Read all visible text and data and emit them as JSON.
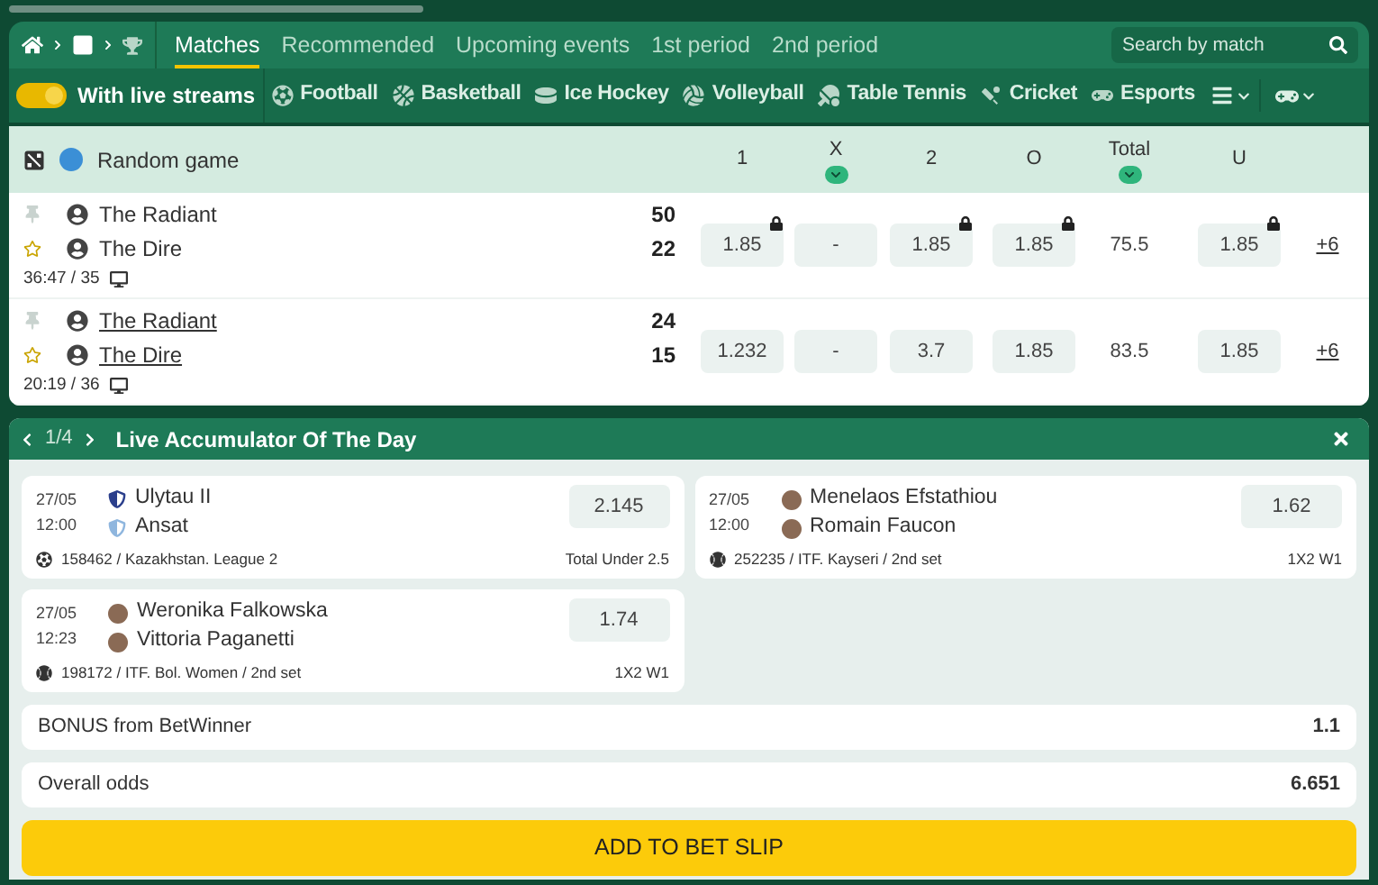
{
  "tabs": [
    {
      "label": "Matches",
      "selected": true
    },
    {
      "label": "Recommended",
      "selected": false
    },
    {
      "label": "Upcoming events",
      "selected": false
    },
    {
      "label": "1st period",
      "selected": false
    },
    {
      "label": "2nd period",
      "selected": false
    }
  ],
  "search": {
    "placeholder": "Search by match"
  },
  "live_toggle": {
    "label": "With live streams",
    "on": true
  },
  "sports": [
    {
      "label": "Football",
      "kind": "football"
    },
    {
      "label": "Basketball",
      "kind": "basketball"
    },
    {
      "label": "Ice Hockey",
      "kind": "hockey"
    },
    {
      "label": "Volleyball",
      "kind": "volleyball"
    },
    {
      "label": "Table Tennis",
      "kind": "tabletennis"
    },
    {
      "label": "Cricket",
      "kind": "cricket"
    },
    {
      "label": "Esports",
      "kind": "esports"
    }
  ],
  "table": {
    "title": "Random game",
    "columns": [
      {
        "label": "1",
        "dropdown": false
      },
      {
        "label": "X",
        "dropdown": true
      },
      {
        "label": "2",
        "dropdown": false
      },
      {
        "label": "O",
        "dropdown": false
      },
      {
        "label": "Total",
        "dropdown": true
      },
      {
        "label": "U",
        "dropdown": false
      }
    ],
    "rows": [
      {
        "teams": [
          {
            "name": "The Radiant",
            "score": "50"
          },
          {
            "name": "The Dire",
            "score": "22"
          }
        ],
        "link": false,
        "time": "36:47 / 35",
        "more": "+6",
        "cells": [
          {
            "kind": "odd",
            "value": "1.85",
            "locked": true
          },
          {
            "kind": "odd",
            "value": "-",
            "locked": false
          },
          {
            "kind": "odd",
            "value": "1.85",
            "locked": true
          },
          {
            "kind": "odd",
            "value": "1.85",
            "locked": true
          },
          {
            "kind": "total",
            "value": "75.5"
          },
          {
            "kind": "odd",
            "value": "1.85",
            "locked": true
          }
        ]
      },
      {
        "teams": [
          {
            "name": "The Radiant",
            "score": "24"
          },
          {
            "name": "The Dire",
            "score": "15"
          }
        ],
        "link": true,
        "time": "20:19 / 36",
        "more": "+6",
        "cells": [
          {
            "kind": "odd",
            "value": "1.232",
            "locked": false
          },
          {
            "kind": "odd",
            "value": "-",
            "locked": false
          },
          {
            "kind": "odd",
            "value": "3.7",
            "locked": false
          },
          {
            "kind": "odd",
            "value": "1.85",
            "locked": false
          },
          {
            "kind": "total",
            "value": "83.5"
          },
          {
            "kind": "odd",
            "value": "1.85",
            "locked": false
          }
        ]
      }
    ]
  },
  "accumulator": {
    "pager": "1/4",
    "title": "Live Accumulator Of The Day",
    "cards": [
      {
        "kind": "football",
        "date": "27/05",
        "time": "12:00",
        "teams": [
          "Ulytau II",
          "Ansat"
        ],
        "odd": "2.145",
        "info": "158462 / Kazakhstan. League 2",
        "bet": "Total Under 2.5"
      },
      {
        "kind": "tennis",
        "date": "27/05",
        "time": "12:00",
        "teams": [
          "Menelaos Efstathiou",
          "Romain Faucon"
        ],
        "odd": "1.62",
        "info": "252235 / ITF. Kayseri / 2nd set",
        "bet": "1X2 W1"
      },
      {
        "kind": "tennis",
        "date": "27/05",
        "time": "12:23",
        "teams": [
          "Weronika Falkowska",
          "Vittoria Paganetti"
        ],
        "odd": "1.74",
        "info": "198172 / ITF. Bol. Women / 2nd set",
        "bet": "1X2 W1"
      }
    ],
    "summary": [
      {
        "label": "BONUS from BetWinner",
        "value": "1.1"
      },
      {
        "label": "Overall odds",
        "value": "6.651"
      }
    ],
    "button": "ADD TO BET SLIP"
  }
}
